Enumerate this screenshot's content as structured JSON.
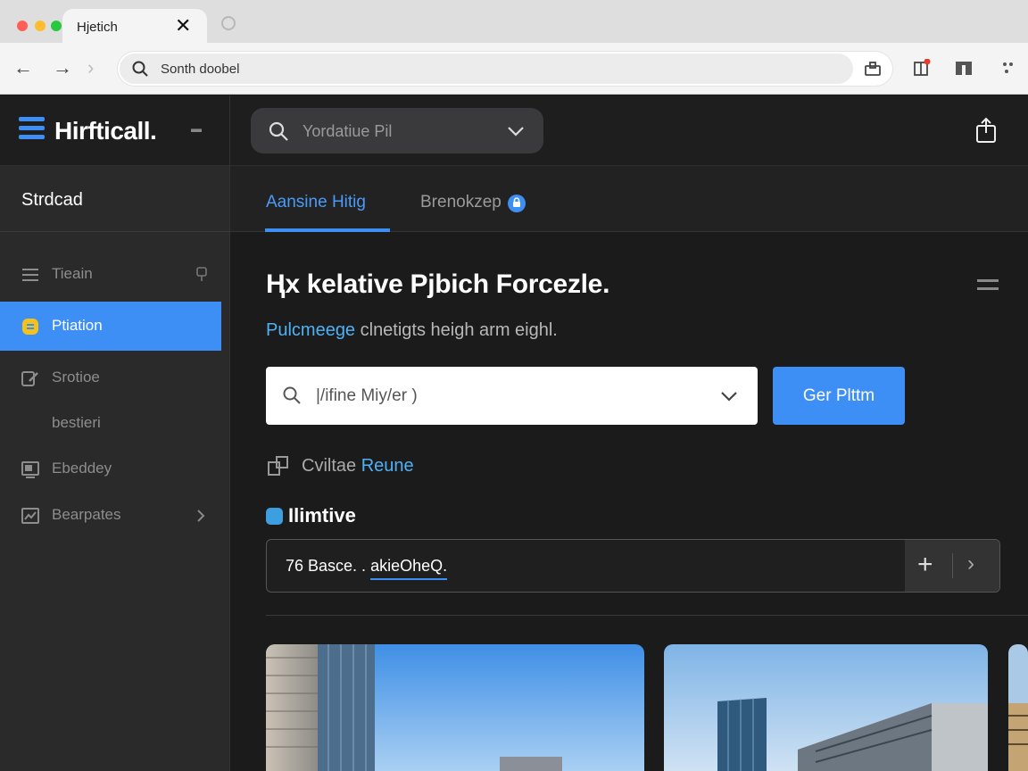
{
  "browser": {
    "tab_title": "Hjetich",
    "tab_close": "✕",
    "address": "Sonth doobel",
    "traffic_colors": [
      "#ff5f57",
      "#febc2e",
      "#28c840"
    ]
  },
  "app": {
    "brand": "Hirfticall.",
    "search_placeholder": "Yordatiue Pil",
    "accent": "#3d8ff5"
  },
  "sidebar": {
    "section": "Strdcad",
    "items": [
      {
        "label": "Tieain",
        "icon": "menu-icon",
        "active": false
      },
      {
        "label": "Ptiation",
        "icon": "badge-icon",
        "active": true
      },
      {
        "label": "Srotioe",
        "icon": "edit-icon",
        "active": false
      },
      {
        "label": "bestieri",
        "icon": "",
        "active": false
      },
      {
        "label": "Ebeddey",
        "icon": "monitor-icon",
        "active": false
      },
      {
        "label": "Bearpates",
        "icon": "chart-icon",
        "active": false
      }
    ]
  },
  "main": {
    "tabs": [
      {
        "label": "Aansine Hitig",
        "active": true
      },
      {
        "label": "Brenokzep",
        "active": false
      }
    ],
    "heading": "Ⱨx kelative Pjbich Forcezle.",
    "subline_highlight": "Pulcmeege",
    "subline_rest": " clnetigts heigh arm eighl.",
    "dropdown_value": "|/ifine Miy/er )",
    "cta_label": "Ger Plttm",
    "row_plain": "Cviltae",
    "row_link": "Reune",
    "section_title": "Ilimtive",
    "field_prefix": "76 Basce. . ",
    "field_underlined": "akieOheQ.",
    "field_plus": "+",
    "field_close": "›"
  }
}
